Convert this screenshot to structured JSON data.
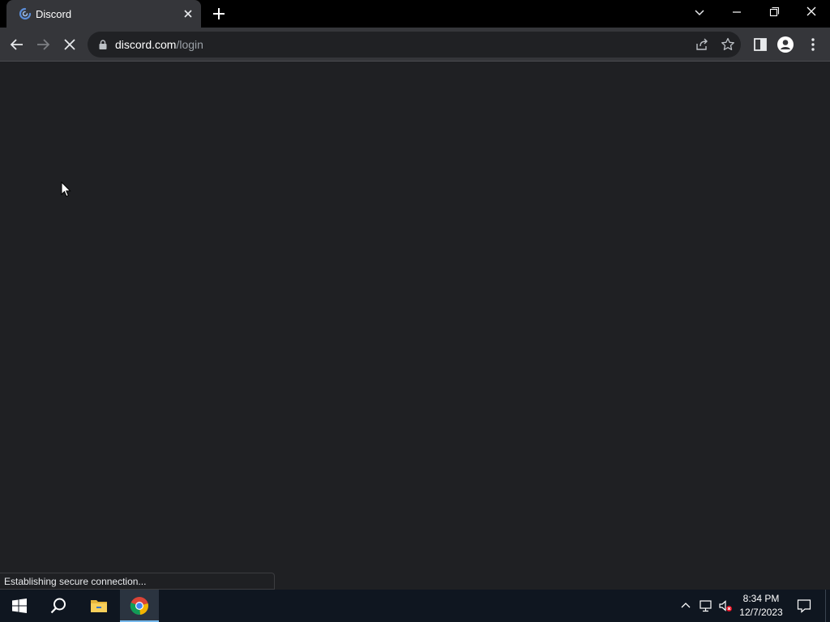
{
  "browser": {
    "tab": {
      "title": "Discord",
      "favicon": "discord-favicon-icon"
    },
    "new_tab_icon": "plus-icon",
    "window_controls": [
      "minimize-icon",
      "restore-icon",
      "close-icon"
    ]
  },
  "toolbar": {
    "url_host": "discord.com",
    "url_path": "/login",
    "icons": [
      "back-arrow-icon",
      "forward-arrow-icon",
      "stop-icon",
      "lock-icon",
      "share-icon",
      "star-icon",
      "side-panel-icon",
      "profile-icon",
      "kebab-menu-icon"
    ]
  },
  "status_bar": {
    "text": "Establishing secure connection..."
  },
  "taskbar": {
    "time": "8:34 PM",
    "date": "12/7/2023",
    "icons": [
      "windows-start-icon",
      "search-icon",
      "file-explorer-icon",
      "chrome-icon",
      "tray-chevron-icon",
      "network-icon",
      "volume-muted-icon",
      "notification-icon"
    ]
  },
  "colors": {
    "page_background": "#1f2023",
    "tabstrip_background": "#000000",
    "toolbar_background": "#35363a",
    "taskbar_background": "#0f1620",
    "url_path": "#9aa0a6"
  }
}
